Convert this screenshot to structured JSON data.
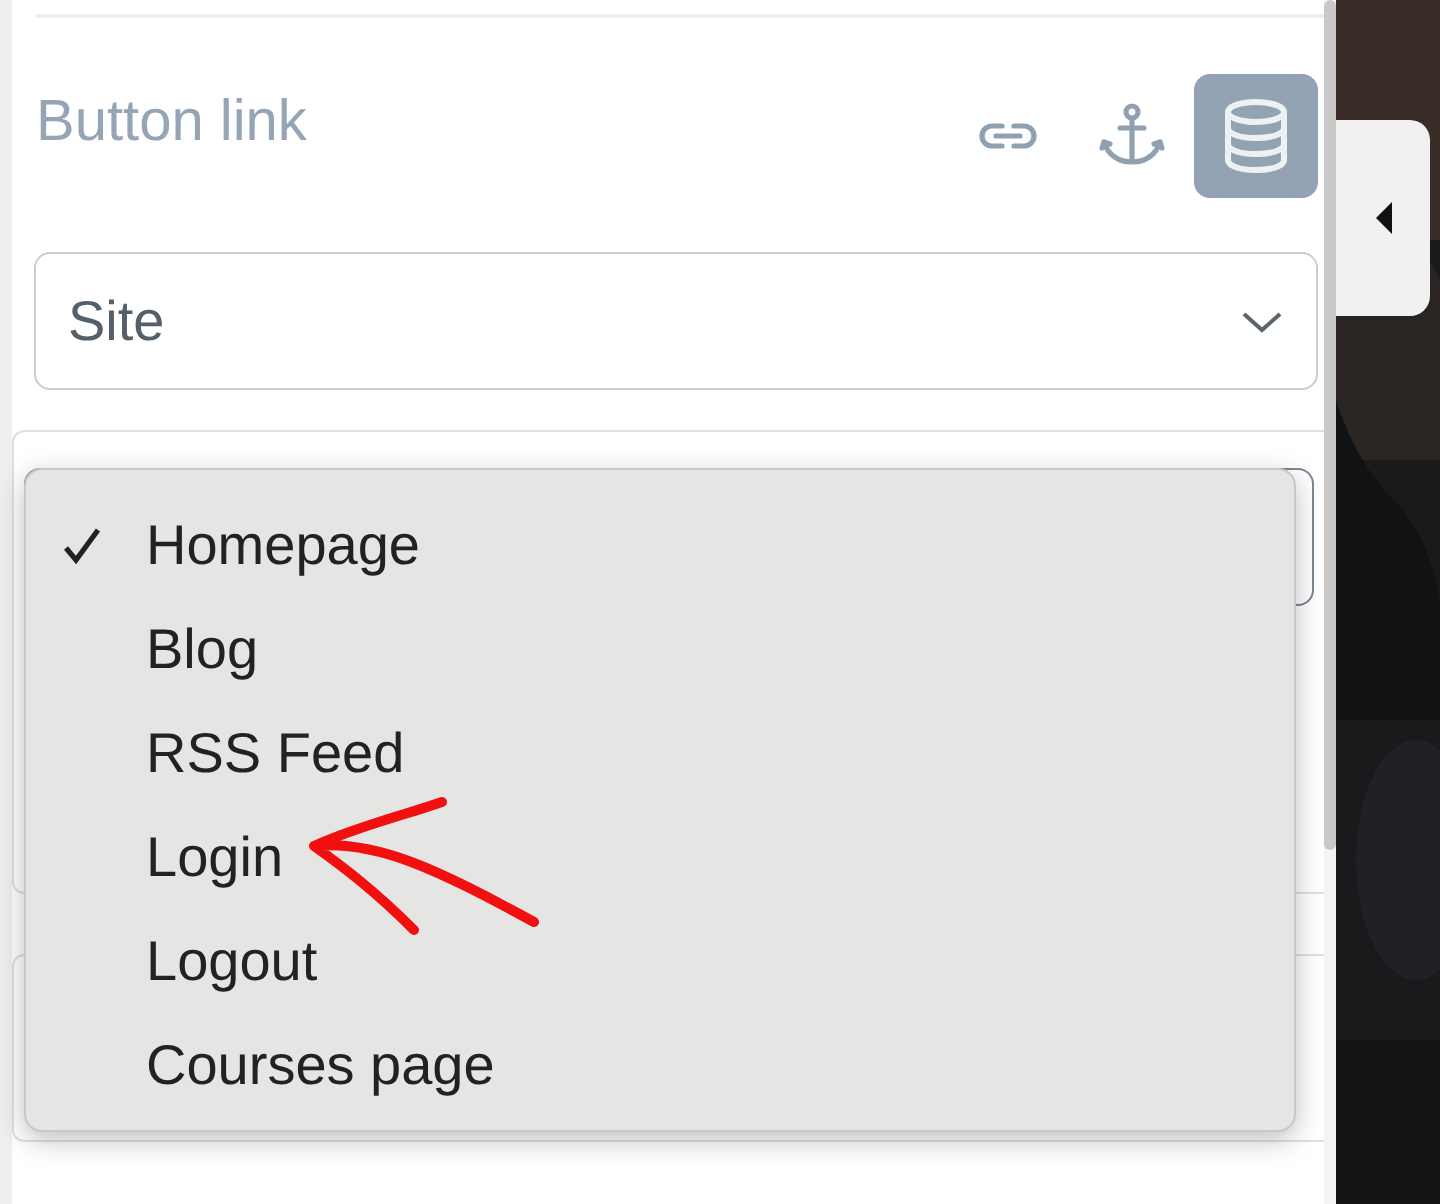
{
  "section": {
    "title": "Button link"
  },
  "link_types": [
    {
      "kind": "link",
      "selected": false
    },
    {
      "kind": "anchor",
      "selected": false
    },
    {
      "kind": "database",
      "selected": true
    }
  ],
  "source_select": {
    "value": "Site"
  },
  "dropdown": {
    "options": [
      {
        "label": "Homepage",
        "selected": true
      },
      {
        "label": "Blog",
        "selected": false
      },
      {
        "label": "RSS Feed",
        "selected": false
      },
      {
        "label": "Login",
        "selected": false
      },
      {
        "label": "Logout",
        "selected": false
      },
      {
        "label": "Courses page",
        "selected": false
      }
    ]
  }
}
